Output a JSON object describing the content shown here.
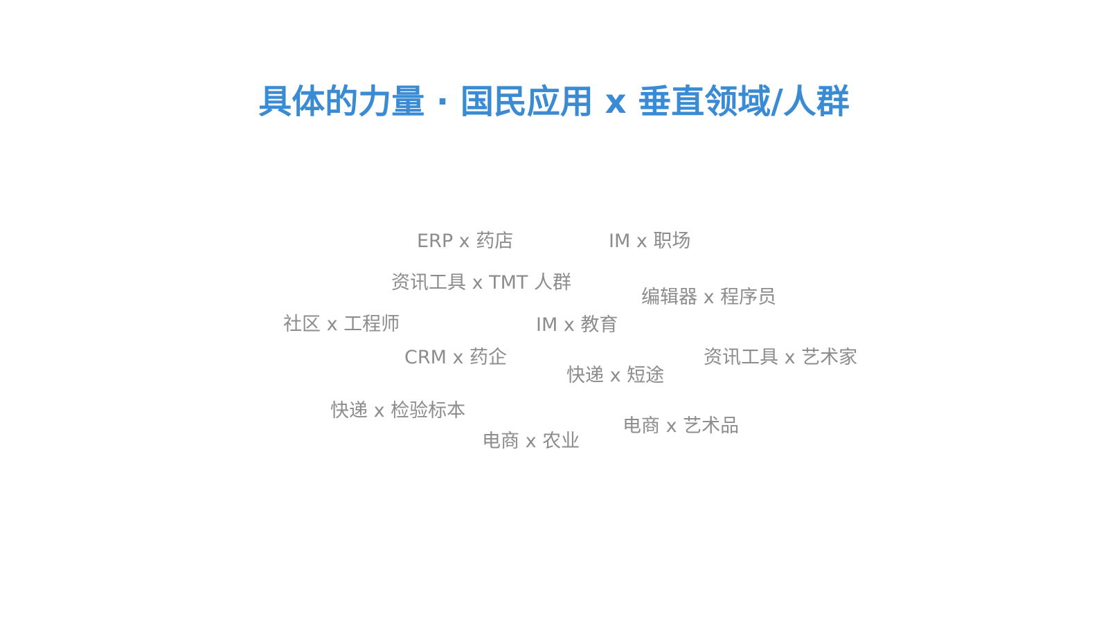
{
  "colors": {
    "title": "#3a8bd4",
    "tag": "#8c8c8c",
    "background": "#ffffff"
  },
  "title": "具体的力量 · 国民应用 x 垂直领域/人群",
  "tags": [
    "ERP x 药店",
    "IM x 职场",
    "资讯工具 x TMT 人群",
    "编辑器 x 程序员",
    "社区 x 工程师",
    "IM x 教育",
    "CRM x 药企",
    "资讯工具 x 艺术家",
    "快递 x 短途",
    "快递 x 检验标本",
    "电商 x 艺术品",
    "电商 x 农业"
  ]
}
